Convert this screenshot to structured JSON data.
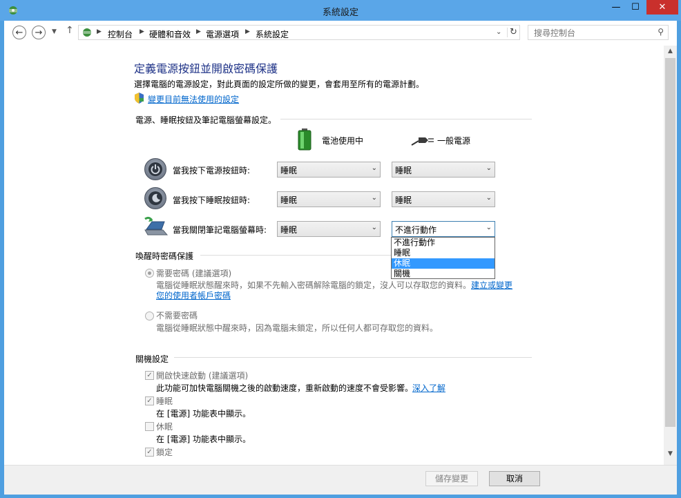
{
  "window": {
    "title": "系統設定",
    "min_icon": "minimize-icon",
    "max_icon": "maximize-icon",
    "close_icon": "close-icon"
  },
  "nav": {
    "breadcrumb": [
      "控制台",
      "硬體和音效",
      "電源選項",
      "系統設定"
    ],
    "search_placeholder": "搜尋控制台"
  },
  "page": {
    "heading": "定義電源按鈕並開啟密碼保護",
    "description": "選擇電腦的電源設定，對此頁面的設定所做的變更，會套用至所有的電源計劃。",
    "change_unavailable_link": "變更目前無法使用的設定"
  },
  "power_section": {
    "title": "電源、睡眠按鈕及筆記電腦螢幕設定。",
    "col_battery": "電池使用中",
    "col_plugged": "一般電源",
    "rows": [
      {
        "label": "當我按下電源按鈕時:",
        "battery": "睡眠",
        "plugged": "睡眠"
      },
      {
        "label": "當我按下睡眠按鈕時:",
        "battery": "睡眠",
        "plugged": "睡眠"
      },
      {
        "label": "當我關閉筆記電腦螢幕時:",
        "battery": "睡眠",
        "plugged": "不進行動作"
      }
    ],
    "dropdown_options": [
      "不進行動作",
      "睡眠",
      "休眠",
      "關機"
    ],
    "dropdown_selected_index": 2
  },
  "wake_section": {
    "title": "喚醒時密碼保護",
    "option1_label": "需要密碼 (建議選項)",
    "option1_desc": "電腦從睡眠狀態醒來時，如果不先輸入密碼解除電腦的鎖定，沒人可以存取您的資料。",
    "option1_link_a": "建立或變更",
    "option1_link_b": "您的使用者帳戶密碼",
    "option2_label": "不需要密碼",
    "option2_desc": "電腦從睡眠狀態中醒來時，因為電腦未鎖定，所以任何人都可存取您的資料。"
  },
  "shutdown_section": {
    "title": "關機設定",
    "fast_startup_label": "開啟快速啟動 (建議選項)",
    "fast_startup_desc": "此功能可加快電腦關機之後的啟動速度，重新啟動的速度不會受影響。",
    "learn_more": "深入了解",
    "sleep_label": "睡眠",
    "sleep_desc": "在 [電源] 功能表中顯示。",
    "hibernate_label": "休眠",
    "hibernate_desc": "在 [電源] 功能表中顯示。",
    "lock_label": "鎖定"
  },
  "footer": {
    "save": "儲存變更",
    "cancel": "取消"
  }
}
